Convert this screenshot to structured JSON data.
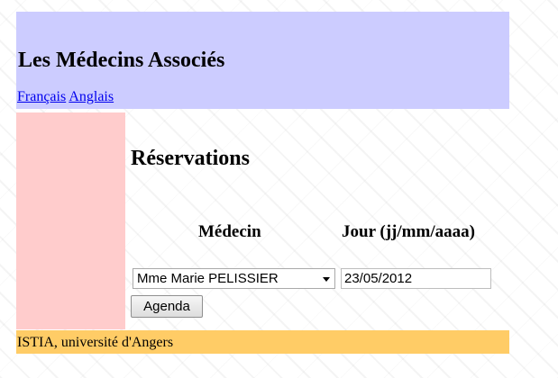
{
  "header": {
    "title": "Les Médecins Associés",
    "languages": [
      "Français",
      "Anglais"
    ]
  },
  "main": {
    "title": "Réservations",
    "columns": {
      "medecin": "Médecin",
      "jour": "Jour (jj/mm/aaaa)"
    },
    "medecin_select": {
      "selected": "Mme Marie PELISSIER"
    },
    "jour_input": {
      "value": "23/05/2012"
    },
    "agenda_button": "Agenda"
  },
  "footer": {
    "text": "ISTIA, université d'Angers"
  },
  "colors": {
    "header_bg": "#ccccff",
    "sidebar_bg": "#ffcccc",
    "footer_bg": "#ffcc66",
    "link": "#0000ee"
  },
  "icons": {
    "select_arrow": "chevron-down-icon"
  }
}
